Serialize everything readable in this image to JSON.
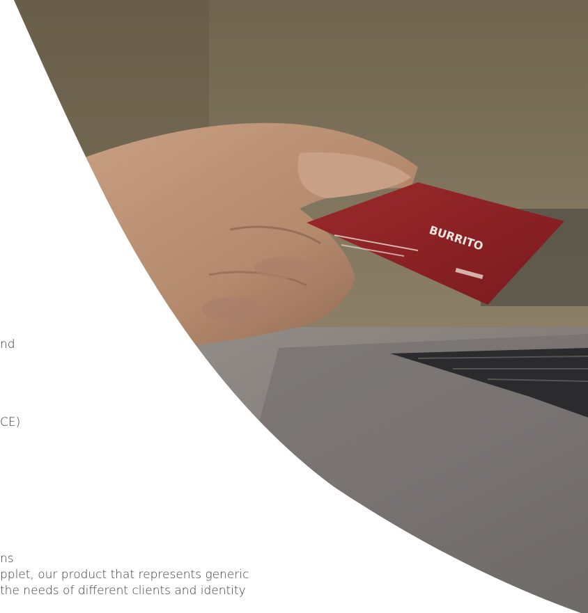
{
  "texts": {
    "line1": "nd",
    "line2": "CE)",
    "line3": "ns",
    "line4": "pplet, our product that represents generic",
    "line5": " the needs of different clients and identity"
  },
  "image": {
    "subject": "hand holding red credit card above laptop",
    "card_text": "BURRITO",
    "colors": {
      "wall": "#7e735e",
      "card": "#8c1f22",
      "skin": "#b98e72",
      "laptop": "#6f6c6d"
    }
  }
}
